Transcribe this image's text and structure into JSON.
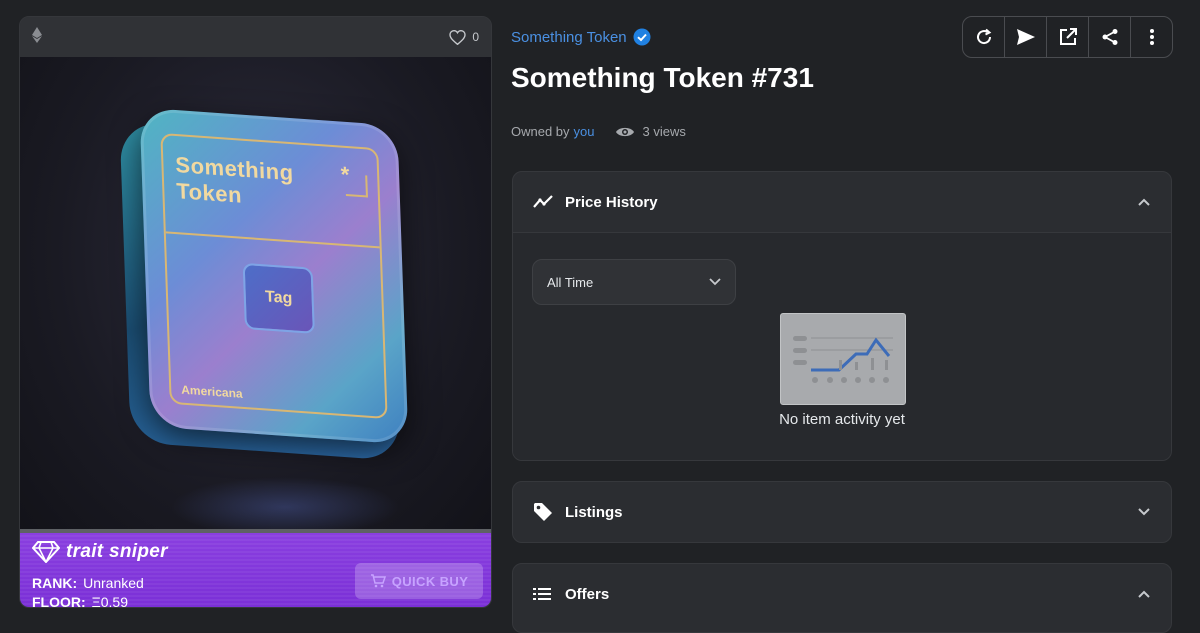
{
  "card": {
    "chain_icon": "ethereum-icon",
    "favorites_count": "0",
    "artwork": {
      "title_line1": "Something",
      "title_line2": "Token",
      "star": "*",
      "tag_label": "Tag",
      "brand": "Americana"
    },
    "trait_sniper": {
      "name": "trait sniper",
      "rank_label": "RANK:",
      "rank_value": "Unranked",
      "floor_label": "FLOOR:",
      "floor_value": "Ξ0.59",
      "quick_buy_label": "QUICK BUY"
    }
  },
  "header": {
    "collection_name": "Something Token",
    "verified_icon": "verified-badge-icon",
    "title": "Something Token #731",
    "owned_by_label": "Owned by",
    "owner": "you",
    "views": "3 views"
  },
  "toolbar": {
    "buttons": [
      "refresh-icon",
      "transfer-icon",
      "external-link-icon",
      "share-icon",
      "more-icon"
    ]
  },
  "price_history": {
    "title": "Price History",
    "range_selected": "All Time",
    "empty_text": "No item activity yet"
  },
  "listings": {
    "title": "Listings"
  },
  "offers": {
    "title": "Offers"
  },
  "colors": {
    "background": "#202225",
    "panel": "#2b2d31",
    "link": "#4a90e2",
    "trait_sniper": "#7a2fd6"
  }
}
